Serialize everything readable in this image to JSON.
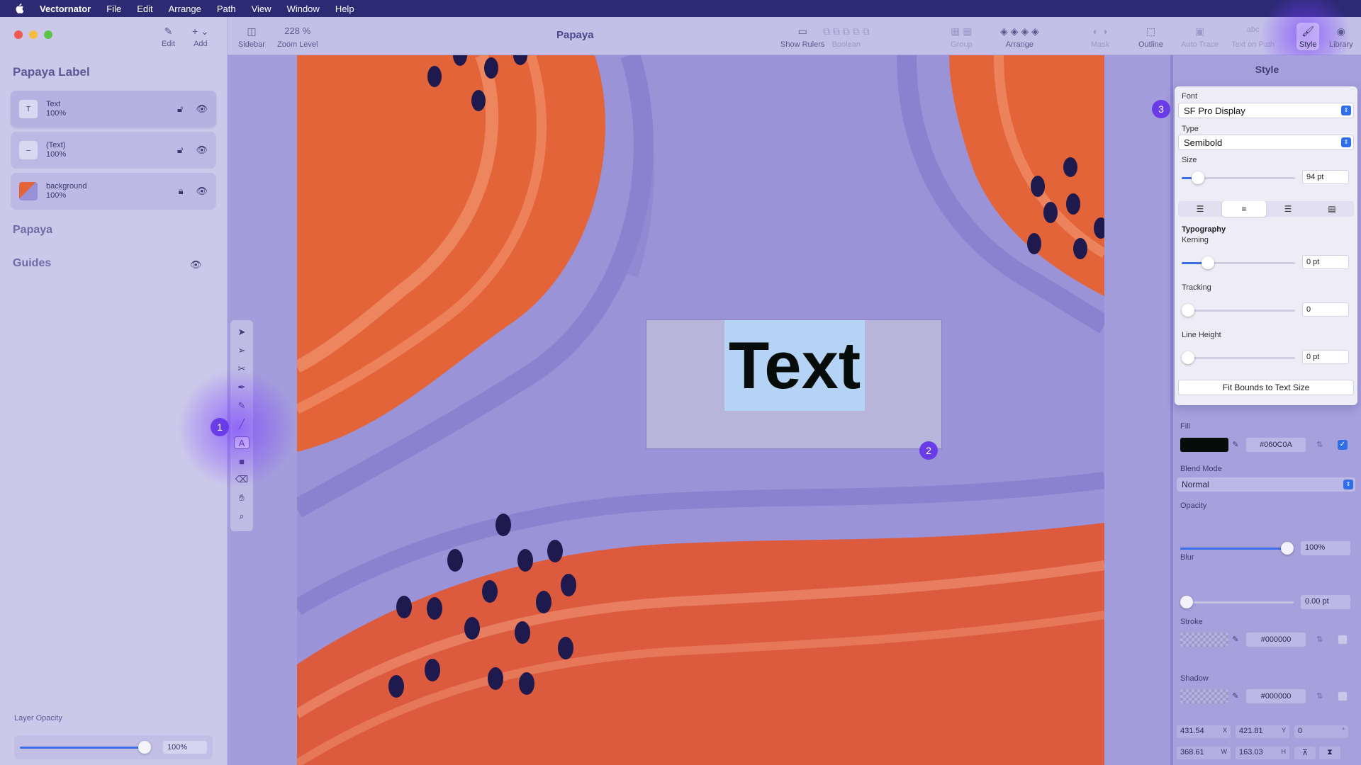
{
  "menubar": {
    "app": "Vectornator",
    "items": [
      "File",
      "Edit",
      "Arrange",
      "Path",
      "View",
      "Window",
      "Help"
    ]
  },
  "sidebar": {
    "tools": [
      {
        "icon": "pencil-icon",
        "label": "Edit"
      },
      {
        "icon": "plus-icon",
        "label": "Add"
      }
    ],
    "title": "Papaya Label",
    "layers": [
      {
        "name": "Text",
        "opacity": "100%",
        "thumb": "T"
      },
      {
        "name": "(Text)",
        "opacity": "100%",
        "thumb": "–"
      },
      {
        "name": "background",
        "opacity": "100%",
        "thumb": ""
      }
    ],
    "section_papaya": "Papaya",
    "section_guides": "Guides",
    "layer_opacity_label": "Layer Opacity",
    "layer_opacity_value": "100%",
    "layer_opacity_fraction": 0.98
  },
  "toolbar": {
    "sidebar_label": "Sidebar",
    "zoom_value": "228 %",
    "zoom_label": "Zoom Level",
    "doc_title": "Papaya",
    "show_rulers": "Show Rulers",
    "boolean": "Boolean",
    "group": "Group",
    "arrange": "Arrange",
    "mask": "Mask",
    "outline": "Outline",
    "auto_trace": "Auto Trace",
    "text_on_path": "Text on Path",
    "style": "Style",
    "library": "Library"
  },
  "canvas": {
    "text": "Text",
    "text_color": "#060C0A"
  },
  "badges": [
    "1",
    "2",
    "3"
  ],
  "style_panel": {
    "header": "Style",
    "font_label": "Font",
    "font_value": "SF Pro Display",
    "type_label": "Type",
    "type_value": "Semibold",
    "size_label": "Size",
    "size_value": "94 pt",
    "size_fraction": 0.1,
    "typography_label": "Typography",
    "kerning_label": "Kerning",
    "kerning_value": "0 pt",
    "kerning_fraction": 0.2,
    "tracking_label": "Tracking",
    "tracking_value": "0",
    "tracking_fraction": 0.0,
    "line_height_label": "Line Height",
    "line_height_value": "0 pt",
    "line_height_fraction": 0.0,
    "fit_button": "Fit Bounds to Text Size",
    "fill_label": "Fill",
    "fill_hex": "#060C0A",
    "fill_enabled": true,
    "blend_label": "Blend Mode",
    "blend_value": "Normal",
    "opacity_label": "Opacity",
    "opacity_value": "100%",
    "opacity_fraction": 1.0,
    "blur_label": "Blur",
    "blur_value": "0.00 pt",
    "blur_fraction": 0.0,
    "stroke_label": "Stroke",
    "stroke_hex": "#000000",
    "shadow_label": "Shadow",
    "shadow_hex": "#000000",
    "pos_x": "431.54",
    "pos_x_unit": "X",
    "pos_y": "421.81",
    "pos_y_unit": "Y",
    "rotation": "0",
    "rotation_unit": "°",
    "width": "368.61",
    "width_unit": "W",
    "height": "163.03",
    "height_unit": "H"
  },
  "colors": {
    "accent": "#6A3CE8",
    "orange": "#E4643A",
    "lavender": "#9B93D8",
    "seed": "#1E1A4E"
  }
}
